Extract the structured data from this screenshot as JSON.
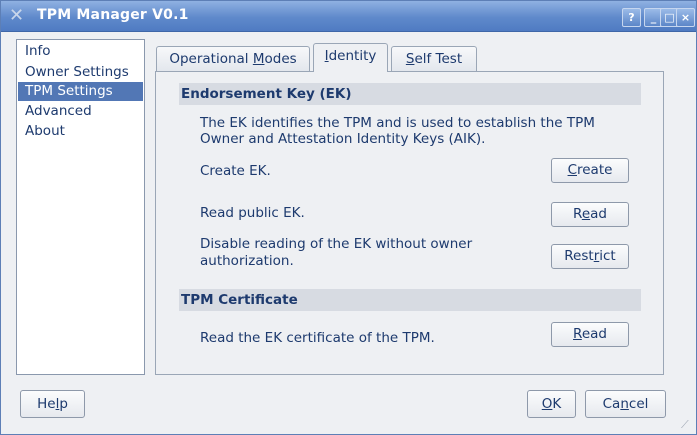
{
  "window": {
    "title": "TPM Manager V0.1",
    "controls": {
      "help": "?",
      "minimize": "_",
      "maximize": "□",
      "close": "×"
    }
  },
  "sidebar": {
    "items": [
      {
        "label": "Info",
        "selected": false
      },
      {
        "label": "Owner Settings",
        "selected": false
      },
      {
        "label": "TPM Settings",
        "selected": true
      },
      {
        "label": "Advanced",
        "selected": false
      },
      {
        "label": "About",
        "selected": false
      }
    ]
  },
  "tabs": [
    {
      "label_pre": "Operational ",
      "label_u": "M",
      "label_post": "odes",
      "active": false
    },
    {
      "label_pre": "",
      "label_u": "I",
      "label_post": "dentity",
      "active": true
    },
    {
      "label_pre": "",
      "label_u": "S",
      "label_post": "elf Test",
      "active": false
    }
  ],
  "ek": {
    "heading": "Endorsement Key (EK)",
    "description_line1": "The EK identifies the TPM and is used to establish the TPM",
    "description_line2": "Owner and Attestation Identity Keys (AIK).",
    "create_text": "Create EK.",
    "create_button": {
      "pre": "",
      "u": "C",
      "post": "reate"
    },
    "read_text": "Read public EK.",
    "read_button": {
      "pre": "R",
      "u": "e",
      "post": "ad"
    },
    "restrict_text_line1": "Disable reading of the EK without owner",
    "restrict_text_line2": "authorization.",
    "restrict_button": {
      "pre": "Rest",
      "u": "r",
      "post": "ict"
    }
  },
  "certificate": {
    "heading": "TPM Certificate",
    "read_text": "Read the EK certificate of the TPM.",
    "read_button": {
      "pre": "",
      "u": "R",
      "post": "ead"
    }
  },
  "footer": {
    "help": {
      "pre": "He",
      "u": "l",
      "post": "p"
    },
    "ok": {
      "pre": "",
      "u": "O",
      "post": "K"
    },
    "cancel": {
      "pre": "Ca",
      "u": "n",
      "post": "cel"
    }
  }
}
